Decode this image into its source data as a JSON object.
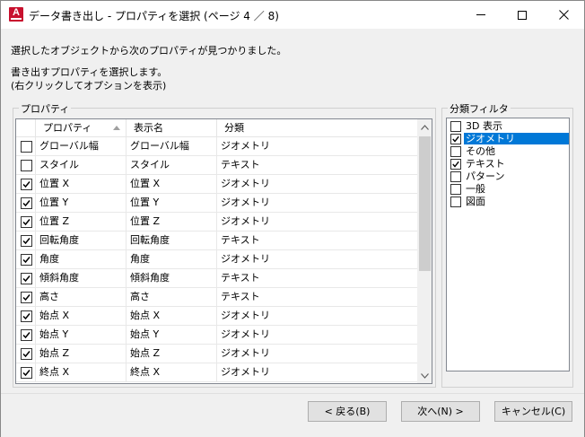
{
  "window": {
    "title": "データ書き出し - プロパティを選択 (ページ 4 ／ 8)"
  },
  "message": {
    "line1": "選択したオブジェクトから次のプロパティが見つかりました。",
    "line2": "書き出すプロパティを選択します。",
    "line3": "(右クリックしてオプションを表示)"
  },
  "properties": {
    "group_label": "プロパティ",
    "columns": {
      "property": "プロパティ",
      "display_name": "表示名",
      "category": "分類"
    },
    "rows": [
      {
        "checked": false,
        "property": "グローバル幅",
        "display_name": "グローバル幅",
        "category": "ジオメトリ"
      },
      {
        "checked": false,
        "property": "スタイル",
        "display_name": "スタイル",
        "category": "テキスト"
      },
      {
        "checked": true,
        "property": "位置 X",
        "display_name": "位置 X",
        "category": "ジオメトリ"
      },
      {
        "checked": true,
        "property": "位置 Y",
        "display_name": "位置 Y",
        "category": "ジオメトリ"
      },
      {
        "checked": true,
        "property": "位置 Z",
        "display_name": "位置 Z",
        "category": "ジオメトリ"
      },
      {
        "checked": true,
        "property": "回転角度",
        "display_name": "回転角度",
        "category": "テキスト"
      },
      {
        "checked": true,
        "property": "角度",
        "display_name": "角度",
        "category": "ジオメトリ"
      },
      {
        "checked": true,
        "property": "傾斜角度",
        "display_name": "傾斜角度",
        "category": "テキスト"
      },
      {
        "checked": true,
        "property": "高さ",
        "display_name": "高さ",
        "category": "テキスト"
      },
      {
        "checked": true,
        "property": "始点 X",
        "display_name": "始点 X",
        "category": "ジオメトリ"
      },
      {
        "checked": true,
        "property": "始点 Y",
        "display_name": "始点 Y",
        "category": "ジオメトリ"
      },
      {
        "checked": true,
        "property": "始点 Z",
        "display_name": "始点 Z",
        "category": "ジオメトリ"
      },
      {
        "checked": true,
        "property": "終点 X",
        "display_name": "終点 X",
        "category": "ジオメトリ"
      }
    ]
  },
  "filter": {
    "group_label": "分類フィルタ",
    "items": [
      {
        "label": "3D 表示",
        "checked": false,
        "selected": false
      },
      {
        "label": "ジオメトリ",
        "checked": true,
        "selected": true
      },
      {
        "label": "その他",
        "checked": false,
        "selected": false
      },
      {
        "label": "テキスト",
        "checked": true,
        "selected": false
      },
      {
        "label": "パターン",
        "checked": false,
        "selected": false
      },
      {
        "label": "一般",
        "checked": false,
        "selected": false
      },
      {
        "label": "図面",
        "checked": false,
        "selected": false
      }
    ]
  },
  "buttons": {
    "back": "< 戻る(B)",
    "next": "次へ(N) >",
    "cancel": "キャンセル(C)"
  },
  "colors": {
    "selection": "#0078d7",
    "app_icon": "#c8102e"
  }
}
